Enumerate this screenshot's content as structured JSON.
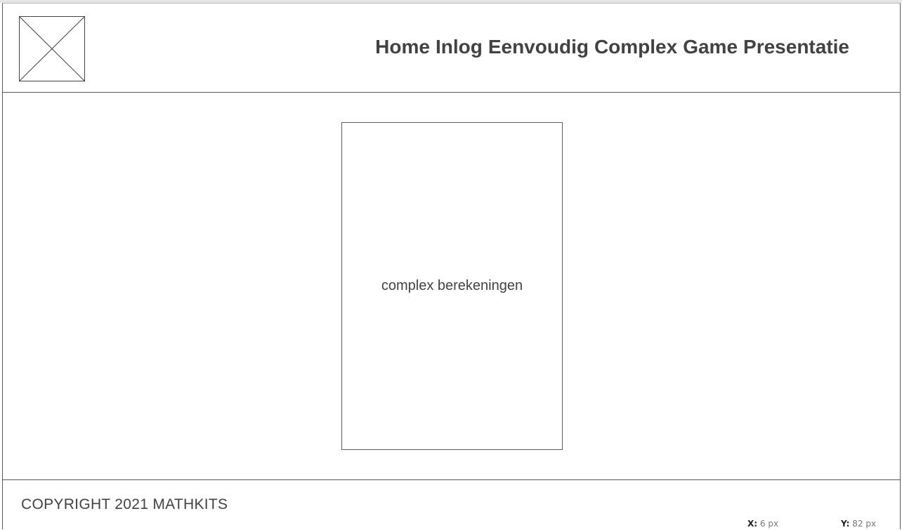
{
  "header": {
    "logo_icon": "image-placeholder-icon",
    "nav": [
      {
        "label": "Home"
      },
      {
        "label": "Inlog"
      },
      {
        "label": "Eenvoudig"
      },
      {
        "label": "Complex"
      },
      {
        "label": "Game"
      },
      {
        "label": "Presentatie"
      }
    ]
  },
  "main": {
    "card_text": "complex berekeningen"
  },
  "footer": {
    "copyright": "COPYRIGHT 2021 MATHKITS"
  },
  "status": {
    "x_label": "X:",
    "x_value": "6 px",
    "y_label": "Y:",
    "y_value": "82 px"
  },
  "colors": {
    "text": "#424242",
    "border": "#5a5a5a",
    "background": "#ffffff"
  }
}
